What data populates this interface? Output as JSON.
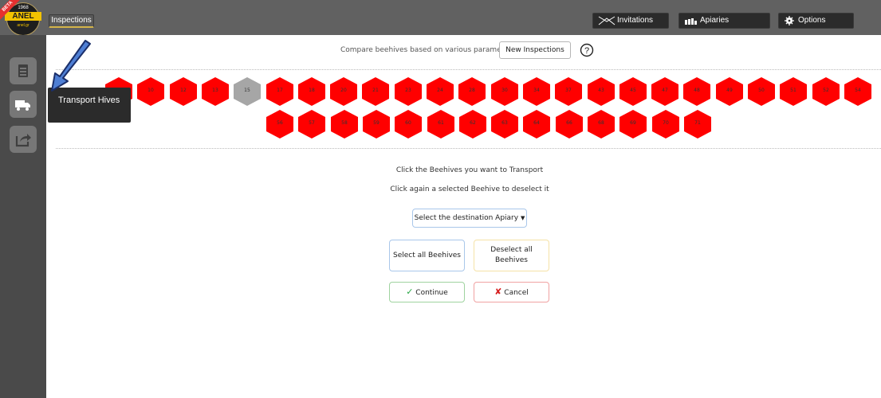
{
  "header": {
    "logo": {
      "year": "1968",
      "word": "ANEL",
      "sub": "anel.gr",
      "beta": "BETA"
    },
    "active_tab": "Inspections",
    "buttons": [
      {
        "label": "Invitations",
        "icon": "invitations-icon"
      },
      {
        "label": "Apiaries",
        "icon": "apiaries-icon"
      },
      {
        "label": "Options",
        "icon": "gear-icon"
      }
    ]
  },
  "sidebar": {
    "items": [
      {
        "icon": "inspections-list-icon"
      },
      {
        "icon": "truck-icon",
        "tooltip": "Transport Hives"
      },
      {
        "icon": "share-icon"
      }
    ]
  },
  "compare": {
    "text": "Compare beehives based on various parameters:",
    "new_inspections": "New Inspections",
    "help_icon": "help-icon"
  },
  "beehives": {
    "row1": [
      "9",
      "10",
      "12",
      "13",
      "15",
      "17",
      "18",
      "20",
      "21",
      "23",
      "24",
      "28",
      "30",
      "34",
      "37",
      "43",
      "45",
      "47",
      "48",
      "49",
      "50",
      "51",
      "52",
      "54"
    ],
    "row2": [
      "56",
      "57",
      "58",
      "59",
      "60",
      "61",
      "62",
      "63",
      "64",
      "66",
      "68",
      "69",
      "70",
      "71"
    ],
    "inactive": [
      "15"
    ],
    "colors": {
      "active": "#ff0000",
      "inactive": "#a6a6a6"
    }
  },
  "transport": {
    "instruction1": "Click the Beehives you want to Transport",
    "instruction2": "Click again a selected Beehive to deselect it",
    "destination": "Select the destination Apiary",
    "select_all": "Select all Beehives",
    "deselect_all": "Deselect all Beehives",
    "continue": "Continue",
    "cancel": "Cancel"
  }
}
